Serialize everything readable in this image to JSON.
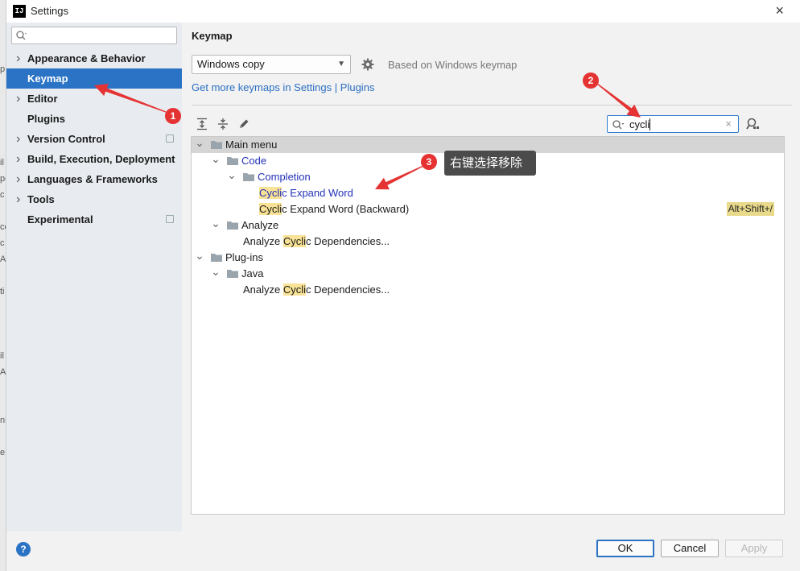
{
  "window": {
    "title": "Settings",
    "app_logo_text": "IJ",
    "close_glyph": "×"
  },
  "sidebar": {
    "search_placeholder": "",
    "items": [
      {
        "label": "Appearance & Behavior",
        "expandable": true,
        "selected": false,
        "project_icon": false
      },
      {
        "label": "Keymap",
        "expandable": false,
        "selected": true,
        "project_icon": false
      },
      {
        "label": "Editor",
        "expandable": true,
        "selected": false,
        "project_icon": false
      },
      {
        "label": "Plugins",
        "expandable": false,
        "selected": false,
        "project_icon": false
      },
      {
        "label": "Version Control",
        "expandable": true,
        "selected": false,
        "project_icon": true
      },
      {
        "label": "Build, Execution, Deployment",
        "expandable": true,
        "selected": false,
        "project_icon": false
      },
      {
        "label": "Languages & Frameworks",
        "expandable": true,
        "selected": false,
        "project_icon": false
      },
      {
        "label": "Tools",
        "expandable": true,
        "selected": false,
        "project_icon": false
      },
      {
        "label": "Experimental",
        "expandable": false,
        "selected": false,
        "project_icon": true
      }
    ]
  },
  "main": {
    "title": "Keymap",
    "keymap_select": "Windows copy",
    "based_on": "Based on Windows keymap",
    "link_prefix": "Get more keymaps in Settings",
    "link_sep": "|",
    "link_plugins": "Plugins",
    "search_value": "cycli",
    "search_clear": "×"
  },
  "tree": {
    "rows": [
      {
        "indent": 0,
        "toggle": "expanded",
        "folder": true,
        "segments": [
          {
            "t": "Main menu",
            "hl": false
          }
        ],
        "blue": false,
        "selected": true,
        "shortcut": ""
      },
      {
        "indent": 1,
        "toggle": "expanded",
        "folder": true,
        "segments": [
          {
            "t": "Code",
            "hl": false
          }
        ],
        "blue": true,
        "selected": false,
        "shortcut": ""
      },
      {
        "indent": 2,
        "toggle": "expanded",
        "folder": true,
        "segments": [
          {
            "t": "Completion",
            "hl": false
          }
        ],
        "blue": true,
        "selected": false,
        "shortcut": ""
      },
      {
        "indent": 3,
        "toggle": "none",
        "folder": false,
        "segments": [
          {
            "t": "Cycli",
            "hl": true
          },
          {
            "t": "c Expand Word",
            "hl": false
          }
        ],
        "blue": true,
        "selected": false,
        "shortcut": ""
      },
      {
        "indent": 3,
        "toggle": "none",
        "folder": false,
        "segments": [
          {
            "t": "Cycli",
            "hl": true
          },
          {
            "t": "c Expand Word (Backward)",
            "hl": false
          }
        ],
        "blue": false,
        "selected": false,
        "shortcut": "Alt+Shift+/"
      },
      {
        "indent": 1,
        "toggle": "expanded",
        "folder": true,
        "segments": [
          {
            "t": "Analyze",
            "hl": false
          }
        ],
        "blue": false,
        "selected": false,
        "shortcut": ""
      },
      {
        "indent": 2,
        "toggle": "none",
        "folder": false,
        "segments": [
          {
            "t": "Analyze ",
            "hl": false
          },
          {
            "t": "Cycli",
            "hl": true
          },
          {
            "t": "c Dependencies...",
            "hl": false
          }
        ],
        "blue": false,
        "selected": false,
        "shortcut": ""
      },
      {
        "indent": 0,
        "toggle": "expanded",
        "folder": true,
        "segments": [
          {
            "t": "Plug-ins",
            "hl": false
          }
        ],
        "blue": false,
        "selected": false,
        "shortcut": ""
      },
      {
        "indent": 1,
        "toggle": "expanded",
        "folder": true,
        "segments": [
          {
            "t": "Java",
            "hl": false
          }
        ],
        "blue": false,
        "selected": false,
        "shortcut": ""
      },
      {
        "indent": 2,
        "toggle": "none",
        "folder": false,
        "segments": [
          {
            "t": "Analyze ",
            "hl": false
          },
          {
            "t": "Cycli",
            "hl": true
          },
          {
            "t": "c Dependencies...",
            "hl": false
          }
        ],
        "blue": false,
        "selected": false,
        "shortcut": ""
      }
    ]
  },
  "footer": {
    "help": "?",
    "ok": "OK",
    "cancel": "Cancel",
    "apply": "Apply"
  },
  "annotations": {
    "badges": [
      "1",
      "2",
      "3"
    ],
    "tip": "右键选择移除",
    "arrow_color": "#e53333"
  },
  "background": {
    "fragments": [
      "p",
      "il",
      "pe",
      "c",
      "co",
      "c",
      "Ap",
      "ti",
      "il",
      "Ap",
      "nl",
      "e"
    ]
  },
  "colors": {
    "accent": "#2a73c5",
    "highlight": "#f8e296",
    "link": "#2a6fc2",
    "tree_blue": "#2231b8"
  }
}
